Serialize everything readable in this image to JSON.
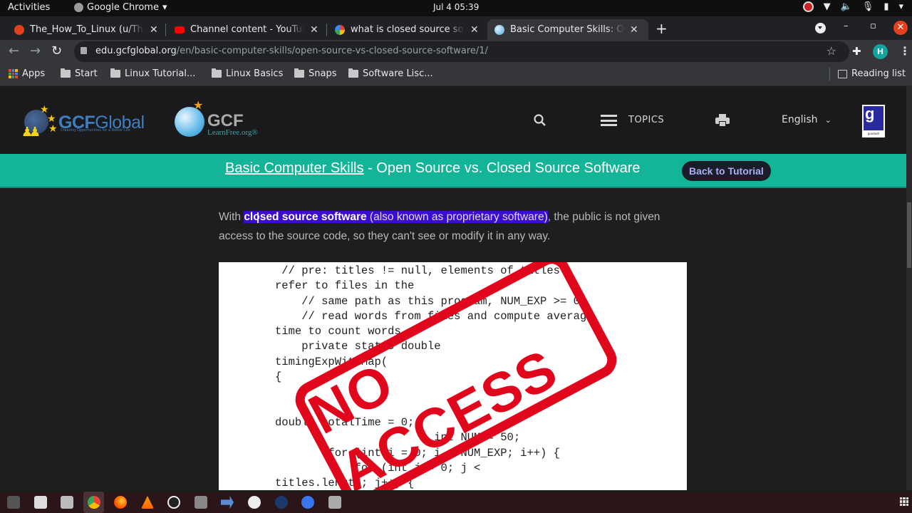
{
  "system_bar": {
    "activities": "Activities",
    "app_name": "Google Chrome",
    "clock": "Jul 4  05:39"
  },
  "tabs": [
    {
      "title": "The_How_To_Linux (u/The_How_To_Linux)",
      "favicon": "reddit-icon",
      "color": "#e0401e",
      "active": false
    },
    {
      "title": "Channel content - YouTube",
      "favicon": "youtube-icon",
      "color": "#ff0000",
      "active": false
    },
    {
      "title": "what is closed source software",
      "favicon": "google-icon",
      "color": "#4285f4",
      "active": false
    },
    {
      "title": "Basic Computer Skills: Open Source vs. Closed Source Software",
      "favicon": "gcf-icon",
      "color": "#4aa8d8",
      "active": true
    }
  ],
  "toolbar": {
    "url_host": "edu.gcfglobal.org",
    "url_path": "/en/basic-computer-skills/open-source-vs-closed-source-software/1/",
    "profile_initial": "H"
  },
  "bookmarks": {
    "apps": "Apps",
    "items": [
      "Start",
      "Linux Tutorial...",
      "Linux Basics",
      "Snaps",
      "Software Lisc..."
    ],
    "reading_list": "Reading list"
  },
  "site_header": {
    "logo1_word_bold": "GCF",
    "logo1_word_light": "Global",
    "logo1_tagline": "Creating Opportunities for a Better Life",
    "logo2_title": "GCF",
    "logo2_sub": "LearnFree.org®",
    "topics": "TOPICS",
    "language": "English",
    "goodwill_label": "goodwill"
  },
  "banner": {
    "course_link": "Basic Computer Skills",
    "separator": " - ",
    "lesson_title": "Open Source vs. Closed Source Software",
    "back_button": "Back to Tutorial"
  },
  "content": {
    "para_lead": "With ",
    "para_bold": "closed source software",
    "para_hl_rest": " (also known as proprietary software)",
    "para_tail": ", the public is not given access to the source code, so they can't see or modify it in any way.",
    "figure_code": " // pre: titles != null, elements of titles\nrefer to files in the\n    // same path as this program, NUM_EXP >= 0\n    // read words from files and compute average\ntime to count words.\n    private static double\ntimingExpWithMap(\n{\n\n\ndouble totalTime = 0;\n                        int NUM = 50;\n        for (int i = 0; i < NUM_EXP; i++) {\n            for (int j = 0; j <\ntitles.length; j++) {",
    "stamp_text": "NO ACCESS"
  },
  "dock": [
    "terminal-icon",
    "mail-icon",
    "screenshot-icon",
    "chrome-icon",
    "firefox-icon",
    "vlc-icon",
    "obs-icon",
    "remote-desktop-icon",
    "vscode-icon",
    "vpn-icon",
    "steam-icon",
    "signal-icon",
    "trash-icon"
  ]
}
